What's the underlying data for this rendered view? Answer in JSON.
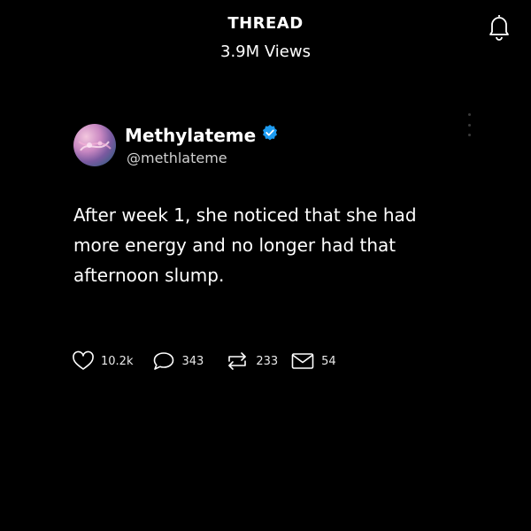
{
  "header": {
    "title": "THREAD",
    "views": "3.9M Views",
    "bell_icon": "bell-icon"
  },
  "author": {
    "display_name": "Methylateme",
    "handle": "@methlateme",
    "verified": true,
    "verified_color": "#1d9bf0"
  },
  "post": {
    "text": "After week 1, she noticed that she had more energy and no longer had that afternoon slump."
  },
  "actions": {
    "likes": "10.2k",
    "comments": "343",
    "reposts": "233",
    "shares": "54"
  }
}
